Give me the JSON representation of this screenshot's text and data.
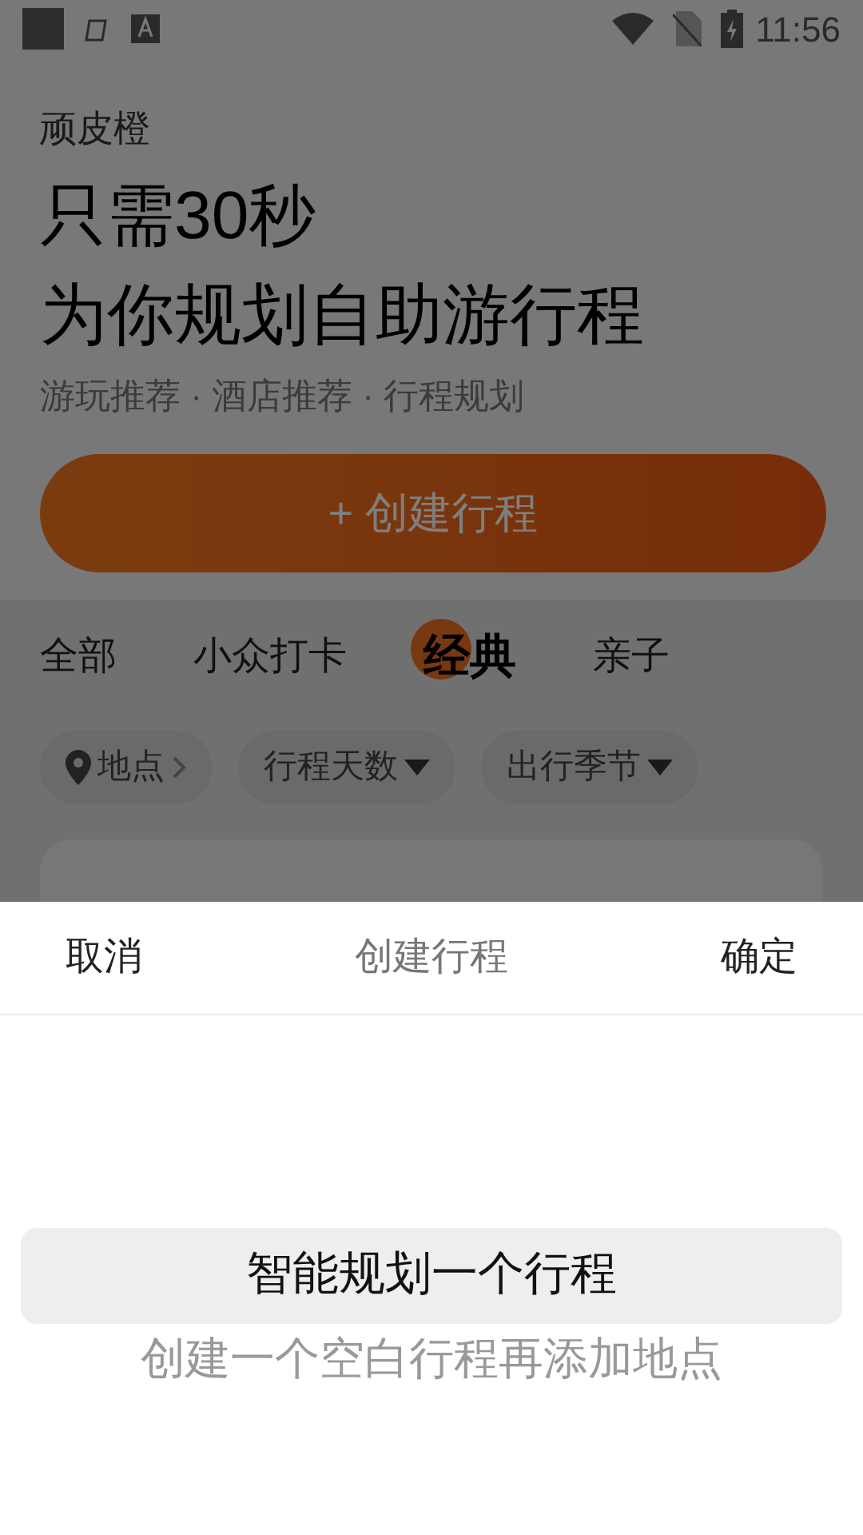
{
  "status_bar": {
    "time": "11:56"
  },
  "header": {
    "brand": "顽皮橙",
    "headline": [
      "只需30秒",
      "为你规划自助游行程"
    ],
    "subtitle": "游玩推荐 · 酒店推荐 · 行程规划",
    "create_button": "+ 创建行程"
  },
  "tabs": [
    {
      "label": "全部",
      "selected": false
    },
    {
      "label": "小众打卡",
      "selected": false
    },
    {
      "label": "经典",
      "selected": true
    },
    {
      "label": "亲子",
      "selected": false
    }
  ],
  "filters": [
    {
      "label": "地点",
      "kind": "location"
    },
    {
      "label": "行程天数",
      "kind": "dropdown"
    },
    {
      "label": "出行季节",
      "kind": "dropdown"
    }
  ],
  "sheet": {
    "cancel": "取消",
    "title": "创建行程",
    "confirm": "确定",
    "options": [
      {
        "label": "智能规划一个行程",
        "selected": true
      },
      {
        "label": "创建一个空白行程再添加地点",
        "selected": false
      }
    ]
  }
}
